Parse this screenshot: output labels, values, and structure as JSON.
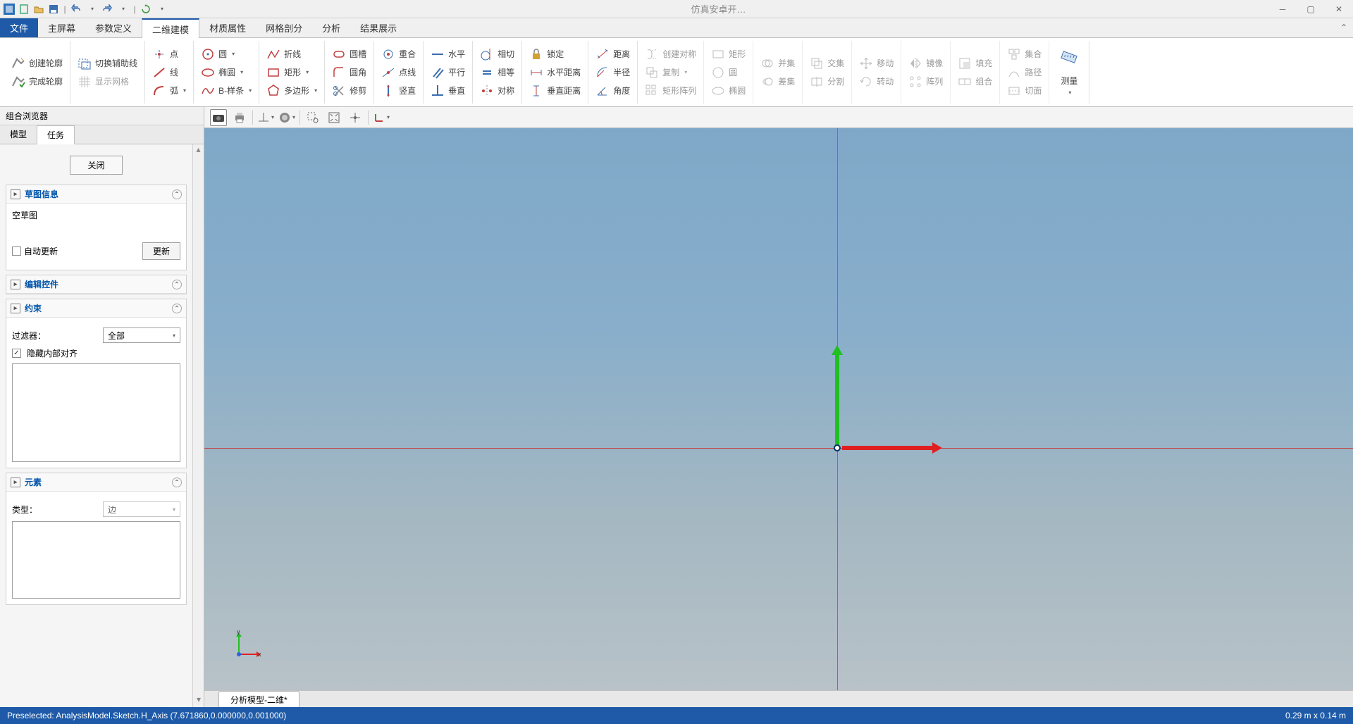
{
  "window": {
    "title": "仿真安卓开…"
  },
  "menu": {
    "file": "文件",
    "tabs": [
      "主屏幕",
      "参数定义",
      "二维建模",
      "材质属性",
      "网格剖分",
      "分析",
      "结果展示"
    ],
    "active_index": 2
  },
  "ribbon": {
    "create_profile": "创建轮廓",
    "finish_profile": "完成轮廓",
    "toggle_aux": "切换辅助线",
    "show_grid": "显示网格",
    "point": "点",
    "line": "线",
    "arc": "弧",
    "circle": "圆",
    "ellipse": "椭圆",
    "bspline": "B-样条",
    "polyline": "折线",
    "rect": "矩形",
    "polygon": "多边形",
    "slot": "圆槽",
    "fillet": "圆角",
    "trim": "修剪",
    "coincident": "重合",
    "point_on": "点线",
    "vertical_c": "竖直",
    "horizontal_c": "水平",
    "parallel": "平行",
    "perpendicular": "垂直",
    "tangent": "相切",
    "equal": "相等",
    "symmetric": "对称",
    "lock": "锁定",
    "hdist": "水平距离",
    "vdist": "垂直距离",
    "distance": "距离",
    "radius": "半径",
    "angle": "角度",
    "create_sym": "创建对称",
    "copy": "复制",
    "rect_array": "矩形阵列",
    "rect2": "矩形",
    "circle2": "圆",
    "ellipse2": "椭圆",
    "union": "并集",
    "diff": "差集",
    "intersect": "交集",
    "split": "分割",
    "move": "移动",
    "rotate": "转动",
    "mirror": "镜像",
    "array": "阵列",
    "fill": "填充",
    "combine": "组合",
    "collect": "集合",
    "path": "路径",
    "cut": "切面",
    "measure": "测量"
  },
  "sidebar": {
    "title": "组合浏览器",
    "tabs": {
      "model": "模型",
      "task": "任务"
    },
    "close": "关闭",
    "sketch_info": {
      "header": "草图信息",
      "empty": "空草图",
      "auto_update": "自动更新",
      "update_btn": "更新"
    },
    "edit_controls": {
      "header": "编辑控件"
    },
    "constraints": {
      "header": "约束",
      "filter_label": "过滤器：",
      "filter_value": "全部",
      "hide_internal": "隐藏内部对齐"
    },
    "elements": {
      "header": "元素",
      "type_label": "类型：",
      "type_value": "边"
    }
  },
  "viewport": {
    "axis_x": "x",
    "axis_y": "y"
  },
  "doc_tab": "分析模型-二维*",
  "statusbar": {
    "left": "Preselected: AnalysisModel.Sketch.H_Axis (7.671860,0.000000,0.001000)",
    "right": "0.29 m x 0.14 m"
  }
}
